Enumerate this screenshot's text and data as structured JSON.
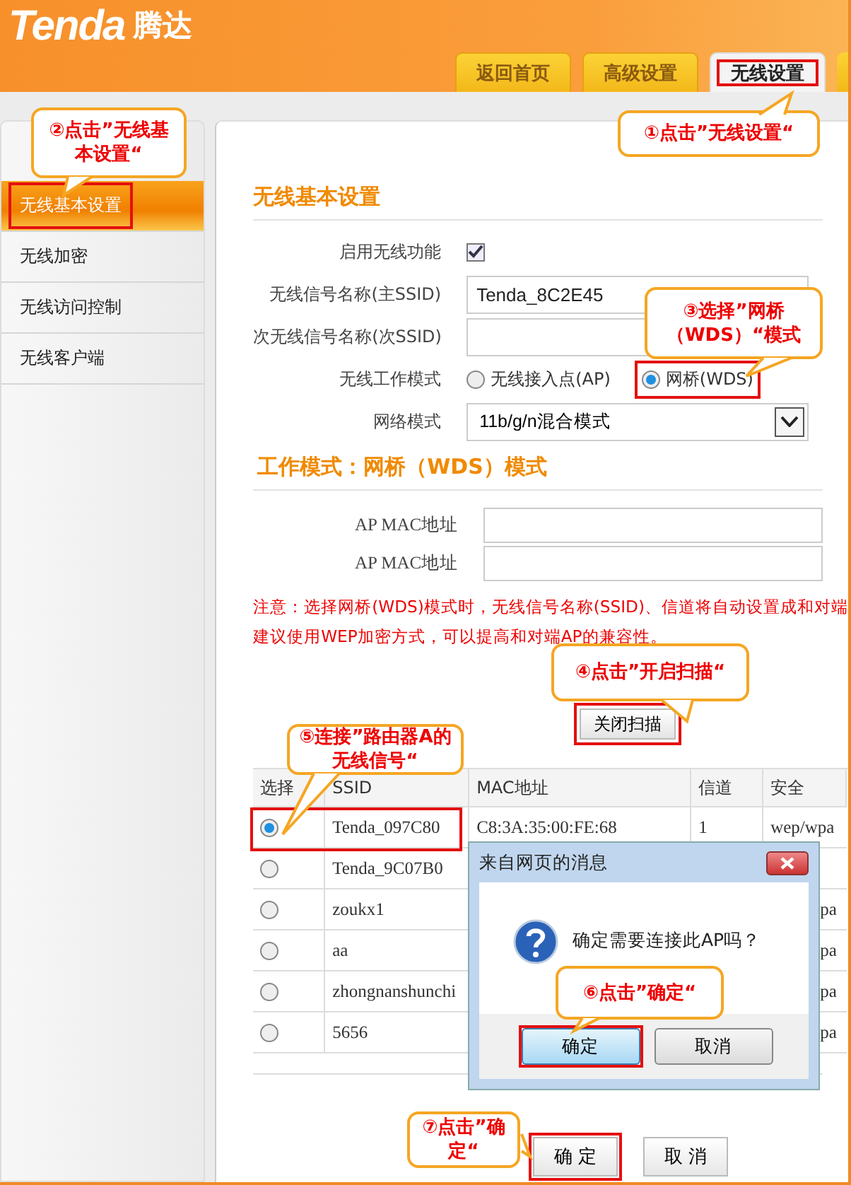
{
  "header": {
    "logo": "Tenda",
    "logo_cn": "腾达",
    "tabs": [
      {
        "label": "返回首页",
        "selected": false,
        "highlighted": false
      },
      {
        "label": "高级设置",
        "selected": false,
        "highlighted": false
      },
      {
        "label": "无线设置",
        "selected": true,
        "highlighted": true
      }
    ]
  },
  "sidebar": {
    "items": [
      {
        "label": "无线基本设置",
        "selected": true,
        "highlighted": true
      },
      {
        "label": "无线加密",
        "selected": false,
        "highlighted": false
      },
      {
        "label": "无线访问控制",
        "selected": false,
        "highlighted": false
      },
      {
        "label": "无线客户端",
        "selected": false,
        "highlighted": false
      }
    ]
  },
  "basic": {
    "title": "无线基本设置",
    "enable_label": "启用无线功能",
    "enabled": true,
    "ssid_label": "无线信号名称(主SSID)",
    "ssid_value": "Tenda_8C2E45",
    "ssid2_label": "次无线信号名称(次SSID)",
    "mode_label": "无线工作模式",
    "modes": [
      {
        "label": "无线接入点(AP)",
        "selected": false,
        "highlighted": false
      },
      {
        "label": "网桥(WDS)",
        "selected": true,
        "highlighted": true
      }
    ],
    "network_label": "网络模式",
    "network_value": "11b/g/n混合模式"
  },
  "wds": {
    "title": "工作模式：网桥（WDS）模式",
    "mac_fields": [
      {
        "label": "AP MAC地址"
      },
      {
        "label": "AP MAC地址"
      }
    ],
    "notice": [
      "注意：选择网桥(WDS)模式时，无线信号名称(SSID)、信道将自动设置成和对端",
      "建议使用WEP加密方式，可以提高和对端AP的兼容性。"
    ],
    "scan_button": {
      "label": "关闭扫描",
      "highlighted": true
    }
  },
  "table": {
    "columns": [
      "选择",
      "SSID",
      "MAC地址",
      "信道",
      "安全"
    ],
    "rows": [
      {
        "selected": true,
        "highlighted": true,
        "ssid": "Tenda_097C80",
        "mac": "C8:3A:35:00:FE:68",
        "channel": "1",
        "security": "wep/wpa"
      },
      {
        "selected": false,
        "highlighted": false,
        "ssid": "Tenda_9C07B0"
      },
      {
        "selected": false,
        "highlighted": false,
        "ssid": "zoukx1",
        "security": "pa"
      },
      {
        "selected": false,
        "highlighted": false,
        "ssid": "aa",
        "security": "pa"
      },
      {
        "selected": false,
        "highlighted": false,
        "ssid": "zhongnanshunchi",
        "security": "pa"
      },
      {
        "selected": false,
        "highlighted": false,
        "ssid": "5656",
        "security": "pa"
      }
    ]
  },
  "dialog": {
    "title": "来自网页的消息",
    "message": "确定需要连接此AP吗？",
    "buttons": [
      {
        "label": "确定",
        "selected": true,
        "highlighted": true
      },
      {
        "label": "取消",
        "selected": false,
        "highlighted": false
      }
    ]
  },
  "footer_buttons": [
    {
      "label": "确 定",
      "highlighted": true
    },
    {
      "label": "取 消",
      "highlighted": false
    }
  ],
  "annotations": [
    {
      "text": "②点击”无线基本设置“"
    },
    {
      "text": "①点击”无线设置“"
    },
    {
      "text": "③选择”网桥（WDS）“模式"
    },
    {
      "text": "④点击”开启扫描“"
    },
    {
      "text": "⑤连接”路由器A的无线信号“"
    },
    {
      "text": "⑥点击”确定“"
    },
    {
      "text": "⑦点击”确定“"
    }
  ]
}
